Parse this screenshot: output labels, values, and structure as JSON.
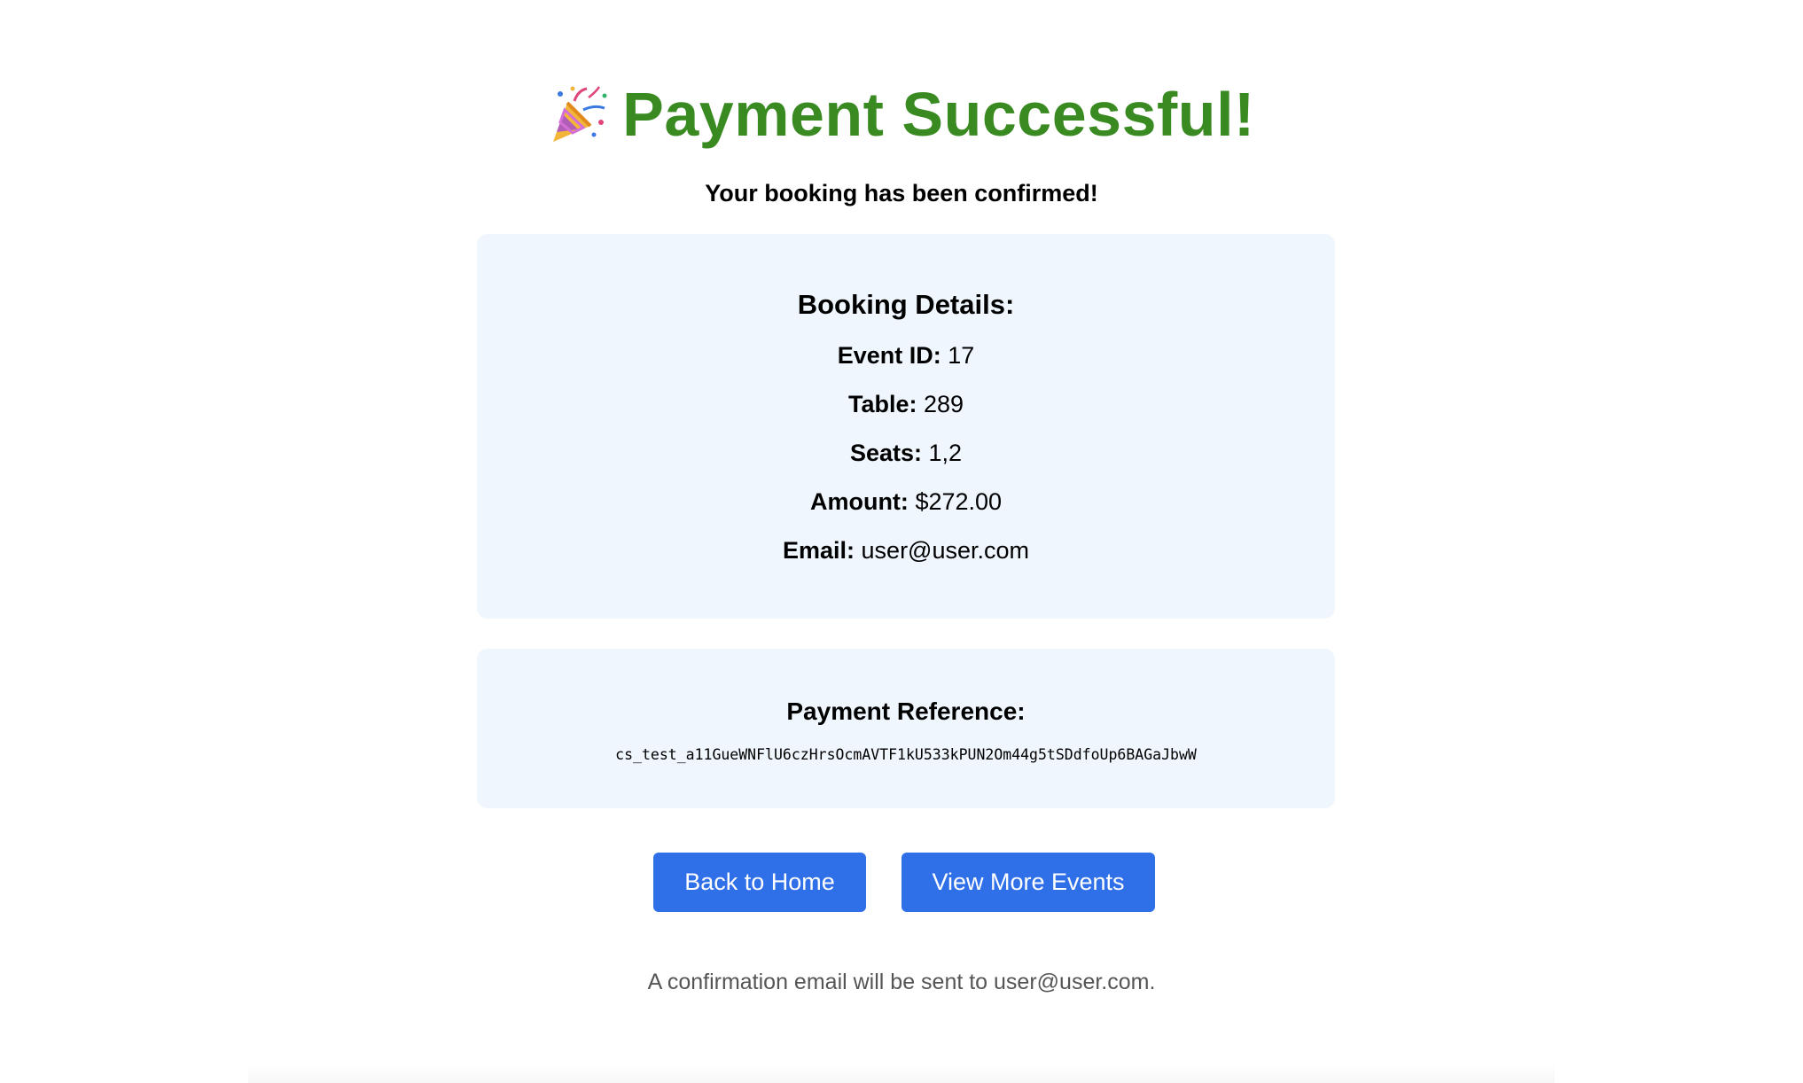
{
  "header": {
    "icon": "party-popper-icon",
    "title": "Payment Successful!",
    "subtitle": "Your booking has been confirmed!"
  },
  "booking": {
    "heading": "Booking Details:",
    "items": [
      {
        "label": "Event ID:",
        "value": "17"
      },
      {
        "label": "Table:",
        "value": "289"
      },
      {
        "label": "Seats:",
        "value": "1,2"
      },
      {
        "label": "Amount:",
        "value": "$272.00"
      },
      {
        "label": "Email:",
        "value": "user@user.com"
      }
    ]
  },
  "payment": {
    "heading": "Payment Reference:",
    "reference": "cs_test_a11GueWNFlU6czHrsOcmAVTF1kU533kPUN2Om44g5tSDdfoUp6BAGaJbwW"
  },
  "actions": {
    "home_label": "Back to Home",
    "events_label": "View More Events"
  },
  "note": "A confirmation email will be sent to user@user.com.",
  "colors": {
    "title": "#3a8a22",
    "card_bg": "#eff6fd",
    "button_bg": "#2f6fe8",
    "note_text": "#555555"
  }
}
